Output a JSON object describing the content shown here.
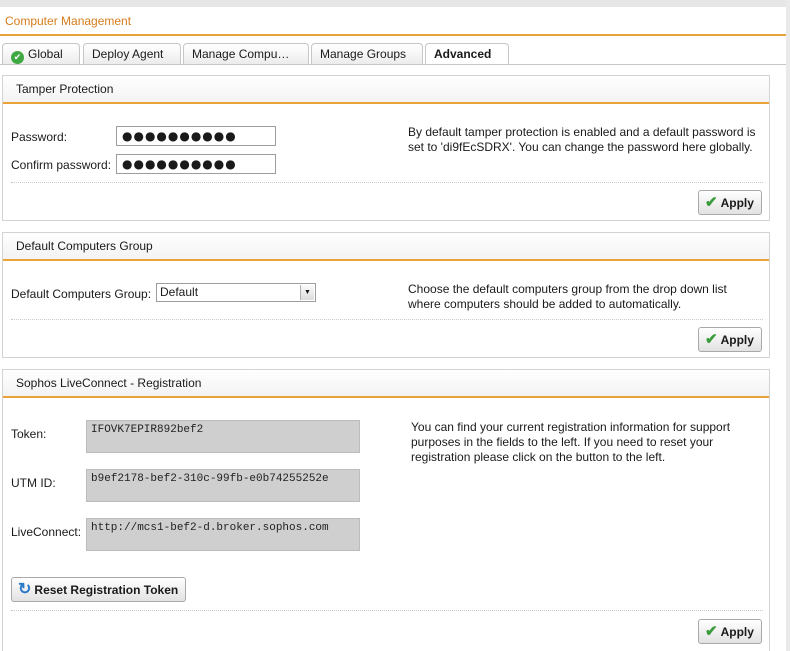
{
  "window": {
    "title": "Computer Management"
  },
  "tabs": [
    {
      "label": "Global"
    },
    {
      "label": "Deploy Agent"
    },
    {
      "label": "Manage Compu…"
    },
    {
      "label": "Manage Groups"
    },
    {
      "label": "Advanced"
    }
  ],
  "tamper": {
    "title": "Tamper Protection",
    "password_label": "Password:",
    "password_value": "●●●●●●●●●●",
    "confirm_label": "Confirm password:",
    "confirm_value": "●●●●●●●●●●",
    "help": "By default tamper protection is enabled and a default password is set to 'di9fEcSDRX'. You can change the password here globally.",
    "apply_label": "Apply"
  },
  "default_group": {
    "title": "Default Computers Group",
    "label": "Default Computers Group:",
    "selected": "Default",
    "help": "Choose the default computers group from the drop down list where computers should be added to automatically.",
    "apply_label": "Apply"
  },
  "liveconnect": {
    "title": "Sophos LiveConnect - Registration",
    "token_label": "Token:",
    "token_value": "IFOVK7EPIR892bef2",
    "utm_label": "UTM ID:",
    "utm_value": "b9ef2178-bef2-310c-99fb-e0b74255252e",
    "lc_label": "LiveConnect:",
    "lc_value": "http://mcs1-bef2-d.broker.sophos.com",
    "help": "You can find your current registration information for support purposes in the fields to the left. If you need to reset your registration please click on the button to the left.",
    "reset_label": "Reset Registration Token",
    "apply_label": "Apply"
  }
}
